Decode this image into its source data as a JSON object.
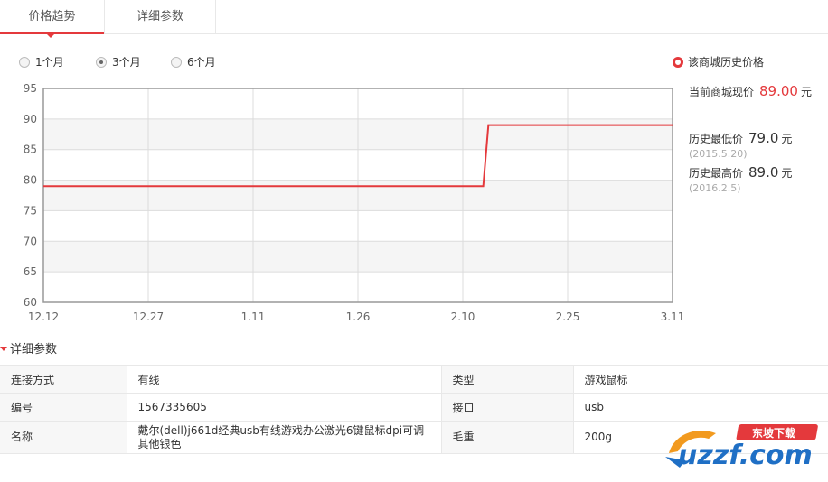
{
  "tabs": [
    "价格趋势",
    "详细参数"
  ],
  "ranges": [
    "1个月",
    "3个月",
    "6个月"
  ],
  "selected_range": "3个月",
  "legend": "该商城历史价格",
  "current": {
    "label": "当前商城现价",
    "price": "89.00",
    "unit": "元"
  },
  "lowest": {
    "label": "历史最低价",
    "price": "79.0",
    "unit": "元",
    "date": "(2015.5.20)"
  },
  "highest": {
    "label": "历史最高价",
    "price": "89.0",
    "unit": "元",
    "date": "(2016.2.5)"
  },
  "chart_data": {
    "type": "line",
    "x_ticks": [
      "12.12",
      "12.27",
      "1.11",
      "1.26",
      "2.10",
      "2.25",
      "3.11"
    ],
    "y_ticks": [
      95,
      90,
      85,
      80,
      75,
      70,
      65,
      60
    ],
    "ylim": [
      60,
      95
    ],
    "series": [
      {
        "points": [
          [
            "12.12",
            79
          ],
          [
            "2.05",
            79
          ],
          [
            "2.06",
            89
          ],
          [
            "3.11",
            89
          ]
        ]
      }
    ],
    "line_color": "#e4393c",
    "grid": true
  },
  "params_title": "详细参数",
  "params": [
    {
      "k1": "连接方式",
      "v1": "有线",
      "k2": "类型",
      "v2": "游戏鼠标"
    },
    {
      "k1": "编号",
      "v1": "1567335605",
      "k2": "接口",
      "v2": "usb"
    },
    {
      "k1": "名称",
      "v1": "戴尔(dell)j661d经典usb有线游戏办公激光6键鼠标dpi可调其他银色",
      "k2": "毛重",
      "v2": "200g"
    }
  ],
  "watermark": {
    "text": "uzzf.com",
    "tag": "东坡下载"
  }
}
